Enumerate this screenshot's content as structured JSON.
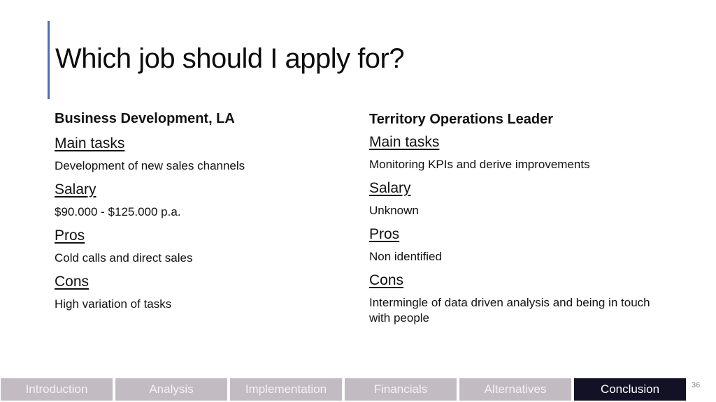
{
  "slide": {
    "title": "Which job should I apply for?",
    "accent_color": "#4f6cb5",
    "page_number": "36"
  },
  "jobs": [
    {
      "title": "Business Development, LA",
      "sections": [
        {
          "heading": "Main tasks",
          "text": "Development of new sales channels"
        },
        {
          "heading": "Salary",
          "text": "$90.000 - $125.000 p.a."
        },
        {
          "heading": "Pros",
          "text": "Cold calls and direct sales"
        },
        {
          "heading": "Cons",
          "text": "High variation of tasks"
        }
      ]
    },
    {
      "title": "Territory Operations Leader",
      "sections": [
        {
          "heading": "Main tasks",
          "text": "Monitoring KPIs and derive improvements"
        },
        {
          "heading": "Salary",
          "text": "Unknown"
        },
        {
          "heading": "Pros",
          "text": "Non identified"
        },
        {
          "heading": "Cons",
          "text": "Intermingle of data driven analysis and being in touch with people"
        }
      ]
    }
  ],
  "nav": {
    "tabs": [
      {
        "label": "Introduction",
        "active": false
      },
      {
        "label": "Analysis",
        "active": false
      },
      {
        "label": "Implementation",
        "active": false
      },
      {
        "label": "Financials",
        "active": false
      },
      {
        "label": "Alternatives",
        "active": false
      },
      {
        "label": "Conclusion",
        "active": true
      }
    ],
    "inactive_color": "#c2bcc2",
    "active_color": "#131126"
  }
}
